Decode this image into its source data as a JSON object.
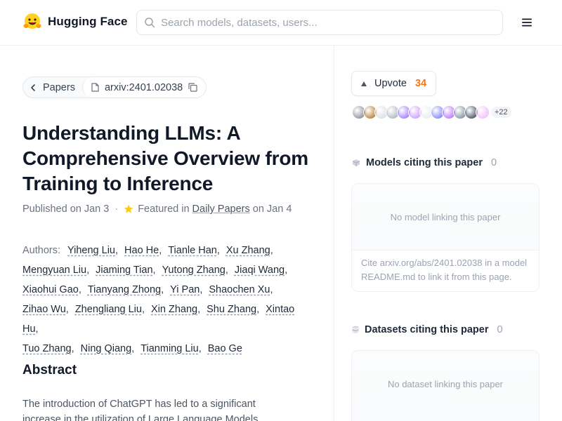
{
  "header": {
    "brand": "Hugging Face",
    "search_placeholder": "Search models, datasets, users...",
    "icons": {
      "search": "search-icon",
      "menu": "hamburger-menu-icon"
    }
  },
  "breadcrumb": {
    "back_label": "Papers",
    "paper_id": "arxiv:2401.02038"
  },
  "paper": {
    "title": "Understanding LLMs: A Comprehensive Overview from Training to Inference",
    "published": "Published on Jan 3",
    "featured_prefix": "Featured in",
    "featured_link": "Daily Papers",
    "featured_suffix": "on Jan 4",
    "authors_label": "Authors:",
    "authors": [
      "Yiheng Liu",
      "Hao He",
      "Tianle Han",
      "Xu Zhang",
      "Mengyuan Liu",
      "Jiaming Tian",
      "Yutong Zhang",
      "Jiaqi Wang",
      "Xiaohui Gao",
      "Tianyang Zhong",
      "Yi Pan",
      "Shaochen Xu",
      "Zihao Wu",
      "Zhengliang Liu",
      "Xin Zhang",
      "Shu Zhang",
      "Xintao Hu",
      "Tuo Zhang",
      "Ning Qiang",
      "Tianming Liu",
      "Bao Ge"
    ],
    "abstract_heading": "Abstract",
    "abstract_text": "The introduction of ChatGPT has led to a significant increase in the utilization of Large Language Models"
  },
  "sidebar": {
    "upvote_label": "Upvote",
    "upvote_count": "34",
    "avatars_more": "+22",
    "avatar_colors": [
      "#6b7280",
      "#a16207",
      "#d1d5db",
      "#9ca3af",
      "#8b5cf6",
      "#c084fc",
      "#e5e7eb",
      "#6366f1",
      "#a855f7",
      "#64748b",
      "#1e293b",
      "#f0abfc"
    ],
    "models": {
      "heading": "Models citing this paper",
      "count": "0",
      "empty": "No model linking this paper",
      "cite": "Cite arxiv.org/abs/2401.02038 in a model README.md to link it from this page."
    },
    "datasets": {
      "heading": "Datasets citing this paper",
      "count": "0",
      "empty": "No dataset linking this paper"
    }
  },
  "colors": {
    "accent": "#f97316",
    "star": "#facc15",
    "text": "#111827",
    "muted": "#6b7280"
  }
}
